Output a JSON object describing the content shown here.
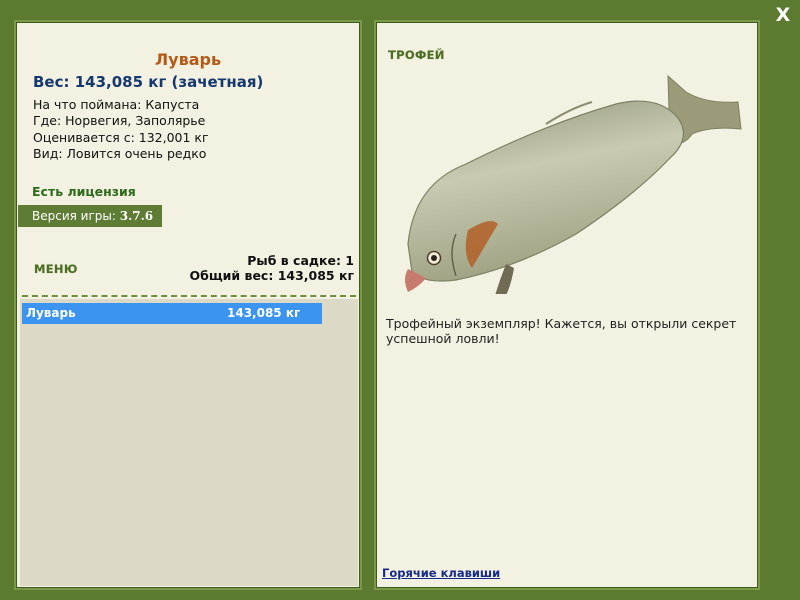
{
  "close_symbol": "X",
  "fish": {
    "name": "Луварь",
    "weight_line": "Вес: 143,085 кг (зачетная)",
    "bait_line": "На что поймана: Капуста",
    "location_line": "Где: Норвегия, Заполярье",
    "rated_line": "Оценивается с: 132,001 кг",
    "rarity_line": "Вид: Ловится очень редко"
  },
  "license": "Есть лицензия",
  "version": {
    "label": "Версия игры:",
    "value": "3.7.6"
  },
  "menu_label": "МЕНЮ",
  "keep_net": {
    "count_line": "Рыб в садке: 1",
    "total_line": "Общий вес: 143,085 кг"
  },
  "catch_list": [
    {
      "name": "Луварь",
      "weight": "143,085 кг"
    }
  ],
  "trophy": {
    "title": "ТРОФЕЙ",
    "text": "Трофейный экземпляр! Кажется, вы открыли секрет успешной ловли!"
  },
  "hotkeys_link": "Горячие клавиши",
  "colors": {
    "frame_green": "#5c7b30",
    "panel_bg": "#f3f1e2",
    "name_orange": "#b35a17",
    "weight_blue": "#15386e",
    "selected_row": "#3b94f0"
  },
  "icons": {
    "close": "close-icon",
    "fish_image": "luvar-fish-image"
  }
}
